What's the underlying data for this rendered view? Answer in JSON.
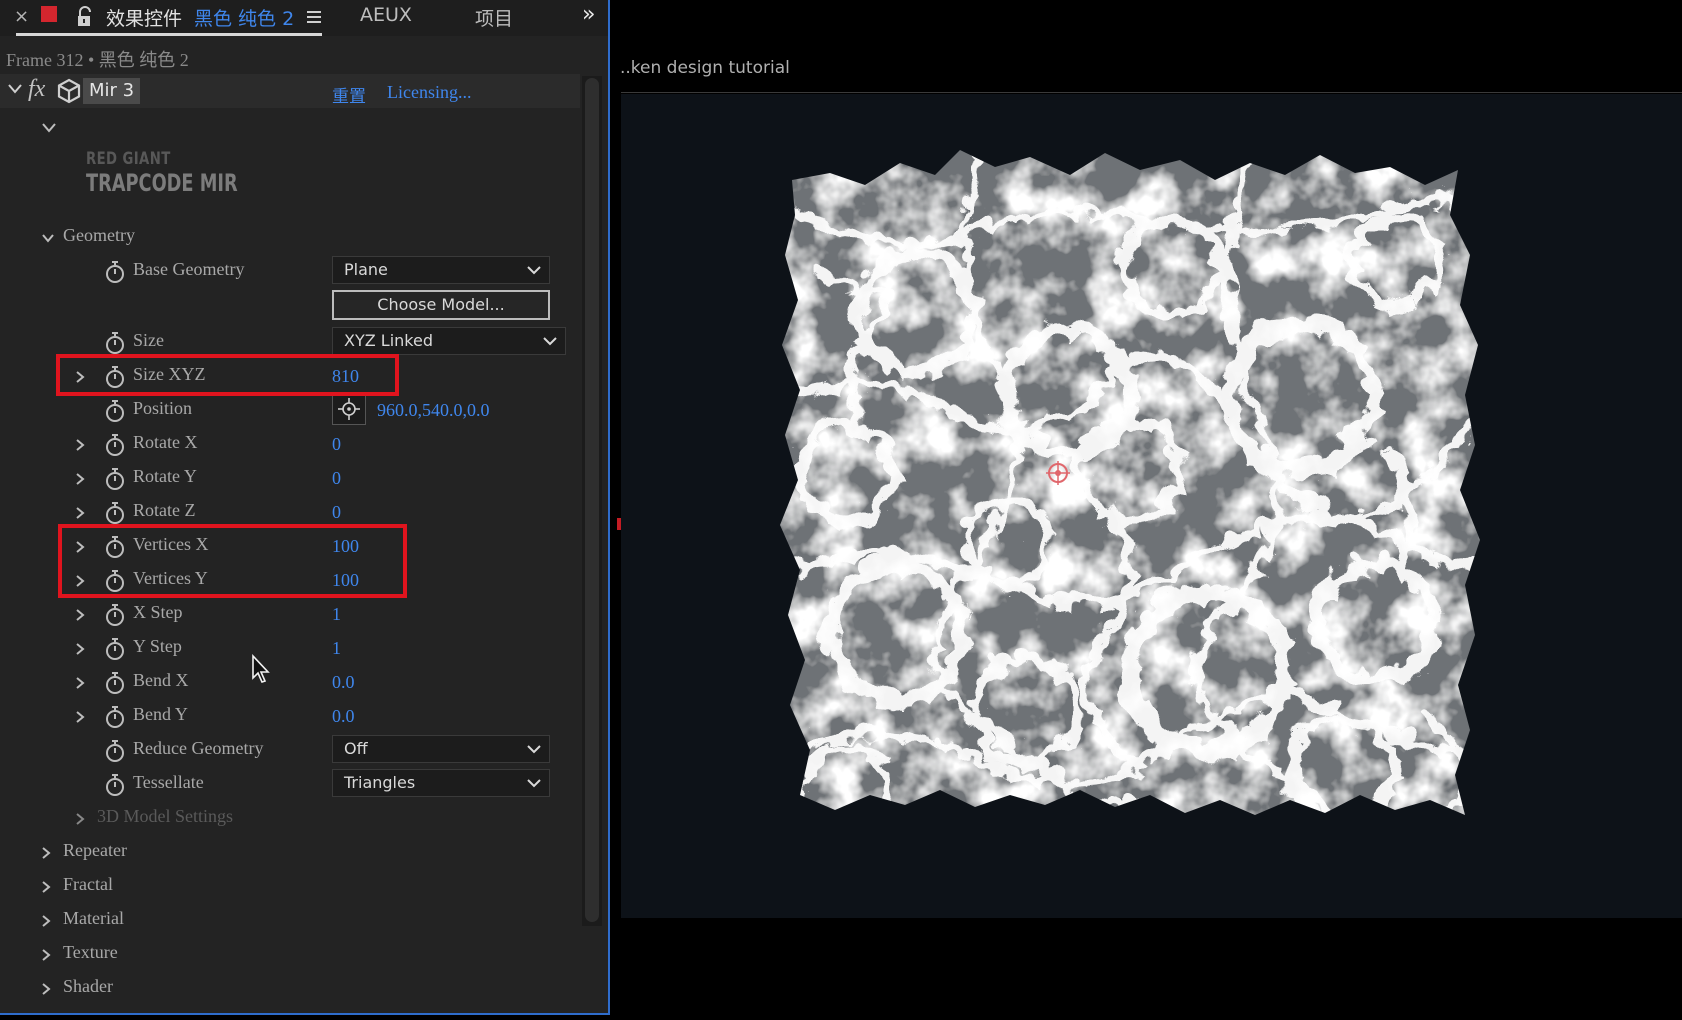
{
  "tabs": {
    "close": "×",
    "title": "效果控件",
    "layer": "黑色 纯色 2",
    "aeux": "AEUX",
    "project": "项目",
    "more": "»"
  },
  "frame_line": "Frame 312 • 黑色 纯色 2",
  "effect": {
    "fx": "fx",
    "name": "Mir 3",
    "reset": "重置",
    "licensing": "Licensing..."
  },
  "logo": {
    "line1": "RED GIANT",
    "line2": "TRAPCODE MIR"
  },
  "geometry": {
    "label": "Geometry",
    "base_geometry": {
      "label": "Base Geometry",
      "value": "Plane"
    },
    "choose_model": "Choose Model...",
    "size": {
      "label": "Size",
      "value": "XYZ Linked"
    },
    "size_xyz": {
      "label": "Size XYZ",
      "value": "810"
    },
    "position": {
      "label": "Position",
      "value": "960.0,540.0,0.0"
    },
    "rotate_x": {
      "label": "Rotate X",
      "value": "0"
    },
    "rotate_y": {
      "label": "Rotate Y",
      "value": "0"
    },
    "rotate_z": {
      "label": "Rotate Z",
      "value": "0"
    },
    "vertices_x": {
      "label": "Vertices X",
      "value": "100"
    },
    "vertices_y": {
      "label": "Vertices Y",
      "value": "100"
    },
    "x_step": {
      "label": "X Step",
      "value": "1"
    },
    "y_step": {
      "label": "Y Step",
      "value": "1"
    },
    "bend_x": {
      "label": "Bend X",
      "value": "0.0"
    },
    "bend_y": {
      "label": "Bend Y",
      "value": "0.0"
    },
    "reduce_geometry": {
      "label": "Reduce Geometry",
      "value": "Off"
    },
    "tessellate": {
      "label": "Tessellate",
      "value": "Triangles"
    },
    "model_settings": "3D Model Settings"
  },
  "sections": {
    "repeater": "Repeater",
    "fractal": "Fractal",
    "material": "Material",
    "texture": "Texture",
    "shader": "Shader"
  },
  "viewer": {
    "title": "..ken design tutorial"
  },
  "colors": {
    "accent": "#3f86ec",
    "highlight": "#e0141e",
    "panel": "#232323",
    "viewer_bg": "#0d1218"
  }
}
